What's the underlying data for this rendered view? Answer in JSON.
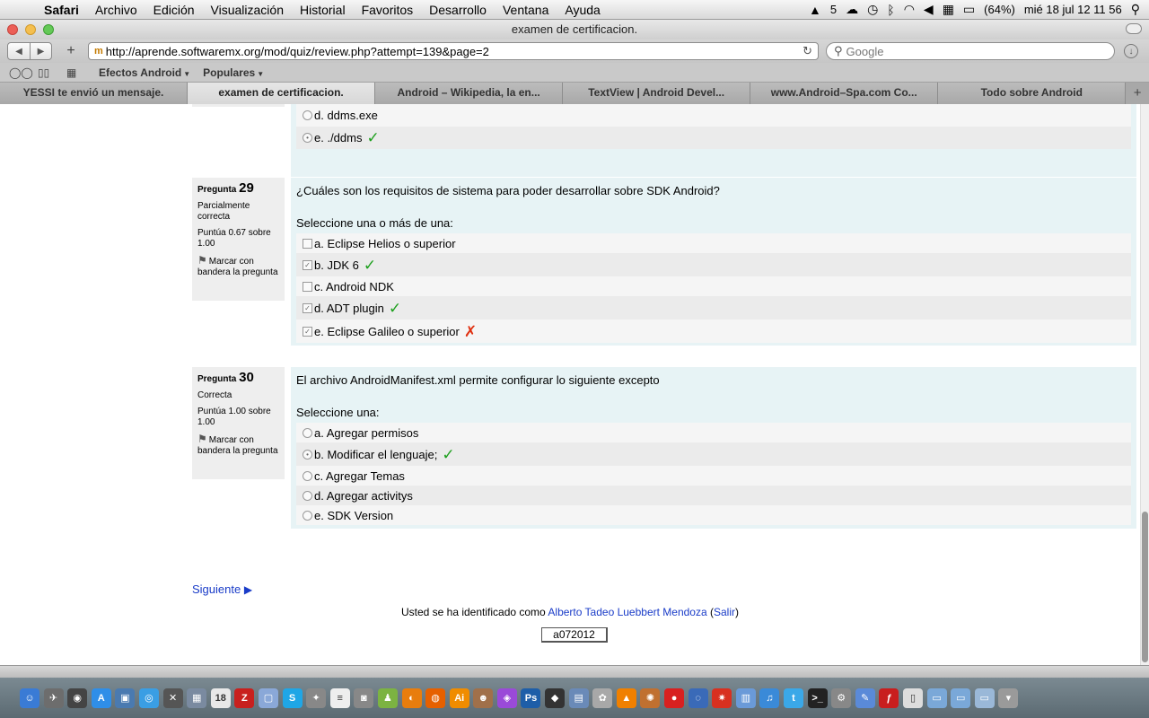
{
  "menubar": {
    "apple": "",
    "items": [
      "Safari",
      "Archivo",
      "Edición",
      "Visualización",
      "Historial",
      "Favoritos",
      "Desarrollo",
      "Ventana",
      "Ayuda"
    ],
    "status": {
      "adobe_count": "5",
      "battery": "(64%)",
      "clock": "mié 18 jul  12 11 56"
    }
  },
  "window": {
    "title": "examen de certificacion."
  },
  "toolbar": {
    "url": "http://aprende.softwaremx.org/mod/quiz/review.php?attempt=139&page=2",
    "search_placeholder": "Google"
  },
  "bookmarks": [
    {
      "label": "Efectos Android"
    },
    {
      "label": "Populares"
    }
  ],
  "tabs": [
    {
      "label": "YESSI te envió un mensaje.",
      "active": false
    },
    {
      "label": "examen de certificacion.",
      "active": true
    },
    {
      "label": "Android – Wikipedia, la en...",
      "active": false
    },
    {
      "label": "TextView | Android Devel...",
      "active": false
    },
    {
      "label": "www.Android–Spa.com Co...",
      "active": false
    },
    {
      "label": "Todo sobre Android",
      "active": false
    }
  ],
  "partial_question": {
    "answers": [
      {
        "label": "d. ddms.exe",
        "selected": false,
        "mark": ""
      },
      {
        "label": "e. ./ddms",
        "selected": true,
        "mark": "ok"
      }
    ]
  },
  "questions": [
    {
      "prefix": "Pregunta",
      "number": "29",
      "state": "Parcialmente correcta",
      "grade": "Puntúa 0.67 sobre 1.00",
      "flag": "Marcar con bandera la pregunta",
      "text": "¿Cuáles son los requisitos de sistema para poder desarrollar sobre SDK Android?",
      "prompt": "Seleccione una o más de una:",
      "answers": [
        {
          "label": "a. Eclipse Helios o superior",
          "checked": false,
          "mark": ""
        },
        {
          "label": "b. JDK 6",
          "checked": true,
          "mark": "ok"
        },
        {
          "label": "c. Android NDK",
          "checked": false,
          "mark": ""
        },
        {
          "label": "d. ADT plugin",
          "checked": true,
          "mark": "ok"
        },
        {
          "label": "e. Eclipse Galileo o superior",
          "checked": true,
          "mark": "bad"
        }
      ]
    },
    {
      "prefix": "Pregunta",
      "number": "30",
      "state": "Correcta",
      "grade": "Puntúa 1.00 sobre 1.00",
      "flag": "Marcar con bandera la pregunta",
      "text": "El archivo AndroidManifest.xml permite configurar lo siguiente excepto",
      "prompt": "Seleccione una:",
      "answers": [
        {
          "label": "a. Agregar permisos",
          "checked": false,
          "mark": ""
        },
        {
          "label": "b. Modificar el lenguaje;",
          "checked": true,
          "mark": "ok"
        },
        {
          "label": "c. Agregar Temas",
          "checked": false,
          "mark": ""
        },
        {
          "label": "d. Agregar activitys",
          "checked": false,
          "mark": ""
        },
        {
          "label": "e. SDK Version",
          "checked": false,
          "mark": ""
        }
      ]
    }
  ],
  "marks": {
    "ok": "✓",
    "bad": "✗"
  },
  "footer": {
    "next_label": "Siguiente",
    "login_prefix": "Usted se ha identificado como ",
    "user_name": "Alberto Tadeo Luebbert Mendoza",
    "logout_label": "Salir",
    "version": "a072012"
  },
  "dock_icons": [
    {
      "name": "finder-icon",
      "color": "#3a7bd5",
      "glyph": "☺"
    },
    {
      "name": "launchpad-icon",
      "color": "#6d6d6d",
      "glyph": "✈"
    },
    {
      "name": "dashboard-icon",
      "color": "#444",
      "glyph": "◉"
    },
    {
      "name": "app-store-icon",
      "color": "#2f8ee8",
      "glyph": "A"
    },
    {
      "name": "preview-icon",
      "color": "#4a7ab0",
      "glyph": "▣"
    },
    {
      "name": "safari-icon",
      "color": "#3a9ee4",
      "glyph": "◎"
    },
    {
      "name": "x11-icon",
      "color": "#555",
      "glyph": "✕"
    },
    {
      "name": "photo-icon",
      "color": "#7a8aa0",
      "glyph": "▦"
    },
    {
      "name": "calendar-icon",
      "color": "#e8e8e8",
      "glyph": "18"
    },
    {
      "name": "filezilla-icon",
      "color": "#c8201e",
      "glyph": "Z"
    },
    {
      "name": "virtualbox-icon",
      "color": "#8aa8d8",
      "glyph": "▢"
    },
    {
      "name": "skype-icon",
      "color": "#1fa6e6",
      "glyph": "S"
    },
    {
      "name": "utility-icon",
      "color": "#888",
      "glyph": "✦"
    },
    {
      "name": "textedit-icon",
      "color": "#eee",
      "glyph": "≡"
    },
    {
      "name": "camera-icon",
      "color": "#888",
      "glyph": "◙"
    },
    {
      "name": "android-icon",
      "color": "#7cb342",
      "glyph": "♟"
    },
    {
      "name": "blender-icon",
      "color": "#e87d0d",
      "glyph": "◐"
    },
    {
      "name": "firefox-icon",
      "color": "#e66000",
      "glyph": "◍"
    },
    {
      "name": "illustrator-icon",
      "color": "#f08c00",
      "glyph": "Ai"
    },
    {
      "name": "character-icon",
      "color": "#a0704a",
      "glyph": "☻"
    },
    {
      "name": "crystal-icon",
      "color": "#9a4ad8",
      "glyph": "◈"
    },
    {
      "name": "photoshop-icon",
      "color": "#1e5ea8",
      "glyph": "Ps"
    },
    {
      "name": "unity-icon",
      "color": "#333",
      "glyph": "◆"
    },
    {
      "name": "box-icon",
      "color": "#6a8ab8",
      "glyph": "▤"
    },
    {
      "name": "animal-icon",
      "color": "#a8a8a8",
      "glyph": "✿"
    },
    {
      "name": "vlc-icon",
      "color": "#f08000",
      "glyph": "▲"
    },
    {
      "name": "game-icon",
      "color": "#c07030",
      "glyph": "✺"
    },
    {
      "name": "angry-birds-icon",
      "color": "#d82020",
      "glyph": "●"
    },
    {
      "name": "globe-icon",
      "color": "#3a6ab8",
      "glyph": "◌"
    },
    {
      "name": "star-icon",
      "color": "#d83020",
      "glyph": "✷"
    },
    {
      "name": "network-icon",
      "color": "#6a9ad8",
      "glyph": "▥"
    },
    {
      "name": "itunes-icon",
      "color": "#3a8ad8",
      "glyph": "♫"
    },
    {
      "name": "twitter-icon",
      "color": "#3aa8e8",
      "glyph": "t"
    },
    {
      "name": "terminal-icon",
      "color": "#222",
      "glyph": ">_"
    },
    {
      "name": "system-preferences-icon",
      "color": "#888",
      "glyph": "⚙"
    },
    {
      "name": "pen-icon",
      "color": "#5a8ad8",
      "glyph": "✎"
    },
    {
      "name": "flash-icon",
      "color": "#c81e1e",
      "glyph": "ƒ"
    },
    {
      "name": "document-icon",
      "color": "#ddd",
      "glyph": "▯"
    },
    {
      "name": "folder-icon",
      "color": "#7aa8d8",
      "glyph": "▭"
    },
    {
      "name": "folder2-icon",
      "color": "#7aa8d8",
      "glyph": "▭"
    },
    {
      "name": "folder3-icon",
      "color": "#9ab8d8",
      "glyph": "▭"
    },
    {
      "name": "trash-icon",
      "color": "#9a9a9a",
      "glyph": "▾"
    }
  ]
}
